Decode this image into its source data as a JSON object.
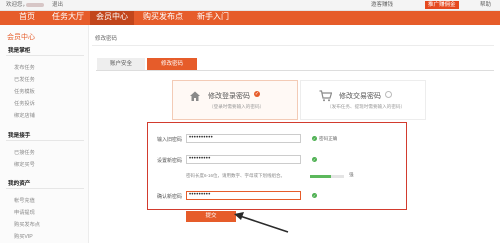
{
  "topbar": {
    "greeting": "欢迎您，",
    "logout": "退出",
    "links": [
      "邀客赚钱",
      "推广赚佣金",
      "帮助"
    ]
  },
  "nav": {
    "items": [
      "首页",
      "任务大厅",
      "会员中心",
      "购买发布点",
      "新手入门"
    ],
    "active_index": 2
  },
  "sidebar": {
    "title": "会员中心",
    "sections": [
      {
        "heading": "我是掌柜",
        "items": [
          "发布任务",
          "已发任务",
          "任务模板",
          "任务投诉",
          "绑定店铺"
        ]
      },
      {
        "heading": "我是接手",
        "items": [
          "已接任务",
          "绑定买号"
        ]
      },
      {
        "heading": "我的资产",
        "items": [
          "帐号充值",
          "申请提现",
          "购买发布点",
          "购买VIP"
        ]
      }
    ]
  },
  "main": {
    "breadcrumb": "修改密码",
    "tabs": [
      "账户安全",
      "修改密码"
    ],
    "active_tab": 1,
    "cards": [
      {
        "title": "修改登录密码",
        "subtitle": "（登录时需要输入的密码）",
        "selected": true,
        "icon": "home-icon"
      },
      {
        "title": "修改交易密码",
        "subtitle": "（发布任务、提现时需要输入的密码）",
        "selected": false,
        "icon": "cart-icon"
      }
    ],
    "form": {
      "old_password": {
        "label": "输入旧密码",
        "value": "••••••••••",
        "hint": "密码正确"
      },
      "new_password": {
        "label": "设置新密码",
        "value": "•••••••••",
        "help": "密码长度6-16位，请用数字、字母或下划线组合。",
        "strength_label": "强",
        "strength": 0.62
      },
      "confirm_password": {
        "label": "确认新密码",
        "value": "•••••••••"
      },
      "submit_label": "提交"
    }
  },
  "colors": {
    "accent": "#e65c2a",
    "highlight_border": "#d23b2e",
    "ok": "#4caf50"
  }
}
